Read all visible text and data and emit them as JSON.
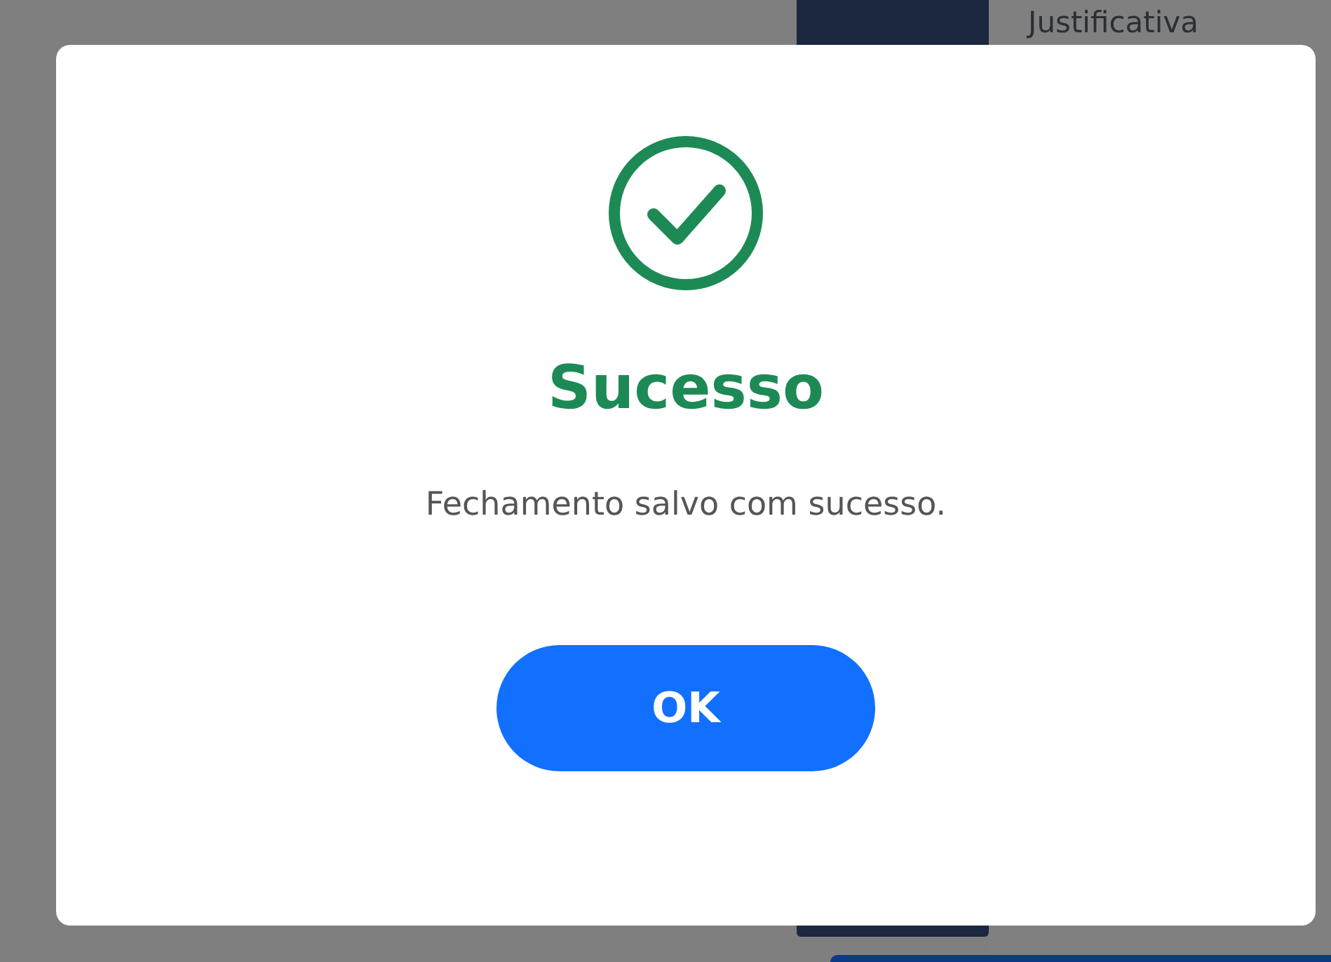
{
  "background": {
    "field_label": "Justificativa"
  },
  "dialog": {
    "kind": "success",
    "title": "Sucesso",
    "message": "Fechamento salvo com sucesso.",
    "button": "OK"
  }
}
